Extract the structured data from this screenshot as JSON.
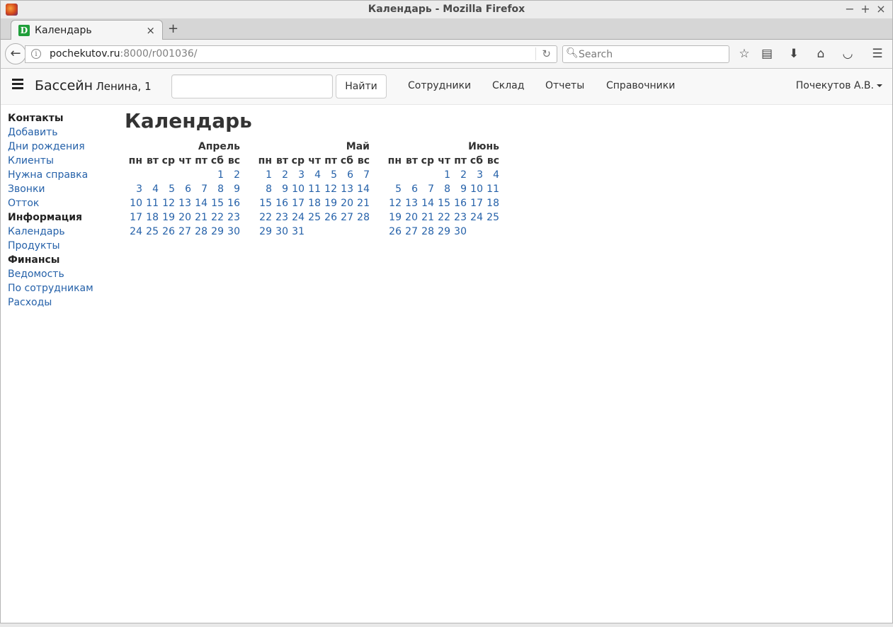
{
  "window": {
    "title": "Календарь - Mozilla Firefox"
  },
  "tab": {
    "label": "Календарь",
    "favicon_letter": "D"
  },
  "browser": {
    "url_host": "pochekutov.ru",
    "url_rest": ":8000/r001036/",
    "search_placeholder": "Search"
  },
  "appnav": {
    "brand": "Бассейн",
    "brand_sub": "Ленина, 1",
    "search_button": "Найти",
    "links": [
      "Сотрудники",
      "Склад",
      "Отчеты",
      "Справочники"
    ],
    "user": "Почекутов А.В."
  },
  "sidebar": {
    "sections": [
      {
        "heading": "Контакты",
        "items": [
          "Добавить",
          "Дни рождения",
          "Клиенты",
          "Нужна справка",
          "Звонки",
          "Отток"
        ]
      },
      {
        "heading": "Информация",
        "items": [
          "Календарь",
          "Продукты"
        ]
      },
      {
        "heading": "Финансы",
        "items": [
          "Ведомость",
          "По сотрудникам",
          "Расходы"
        ]
      }
    ]
  },
  "page": {
    "title": "Календарь"
  },
  "calendar": {
    "weekdays": [
      "пн",
      "вт",
      "ср",
      "чт",
      "пт",
      "сб",
      "вс"
    ],
    "months": [
      {
        "name": "Апрель",
        "weeks": [
          [
            "",
            "",
            "",
            "",
            "",
            "1",
            "2"
          ],
          [
            "3",
            "4",
            "5",
            "6",
            "7",
            "8",
            "9"
          ],
          [
            "10",
            "11",
            "12",
            "13",
            "14",
            "15",
            "16"
          ],
          [
            "17",
            "18",
            "19",
            "20",
            "21",
            "22",
            "23"
          ],
          [
            "24",
            "25",
            "26",
            "27",
            "28",
            "29",
            "30"
          ]
        ]
      },
      {
        "name": "Май",
        "weeks": [
          [
            "1",
            "2",
            "3",
            "4",
            "5",
            "6",
            "7"
          ],
          [
            "8",
            "9",
            "10",
            "11",
            "12",
            "13",
            "14"
          ],
          [
            "15",
            "16",
            "17",
            "18",
            "19",
            "20",
            "21"
          ],
          [
            "22",
            "23",
            "24",
            "25",
            "26",
            "27",
            "28"
          ],
          [
            "29",
            "30",
            "31",
            "",
            "",
            "",
            ""
          ]
        ]
      },
      {
        "name": "Июнь",
        "weeks": [
          [
            "",
            "",
            "",
            "1",
            "2",
            "3",
            "4"
          ],
          [
            "5",
            "6",
            "7",
            "8",
            "9",
            "10",
            "11"
          ],
          [
            "12",
            "13",
            "14",
            "15",
            "16",
            "17",
            "18"
          ],
          [
            "19",
            "20",
            "21",
            "22",
            "23",
            "24",
            "25"
          ],
          [
            "26",
            "27",
            "28",
            "29",
            "30",
            "",
            ""
          ]
        ]
      }
    ]
  }
}
